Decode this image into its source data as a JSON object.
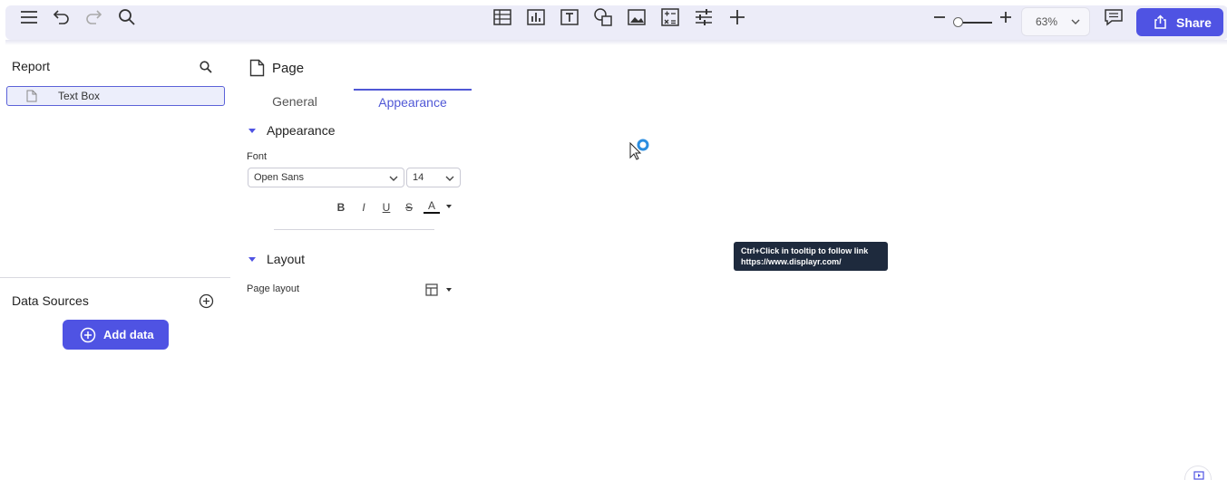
{
  "toolbar": {
    "left_icons": [
      "menu-icon",
      "undo-icon",
      "redo-icon",
      "search-icon"
    ],
    "center_icons": [
      "table-icon",
      "chart-icon",
      "text-icon",
      "shapes-icon",
      "image-icon",
      "calculation-icon",
      "controls-icon",
      "add-icon"
    ],
    "zoom_value": "63%",
    "share_label": "Share"
  },
  "left_panel": {
    "report_title": "Report",
    "report_items": [
      {
        "label": "Text Box"
      }
    ],
    "data_sources_title": "Data Sources",
    "add_data_label": "Add data"
  },
  "right_panel": {
    "page_title": "Page",
    "tabs": [
      {
        "label": "General"
      },
      {
        "label": "Appearance"
      }
    ],
    "active_tab": "Appearance",
    "appearance_section": "Appearance",
    "font_label": "Font",
    "font_value": "Open Sans",
    "font_size_value": "14",
    "format_buttons": [
      "B",
      "I",
      "U",
      "S",
      "A"
    ],
    "layout_section": "Layout",
    "page_layout_label": "Page layout"
  },
  "tooltip": {
    "line1": "Ctrl+Click in tooltip to follow link",
    "line2": "https://www.displayr.com/"
  },
  "colors": {
    "accent": "#4f53e3",
    "toolbar_bg": "#ececf8",
    "tooltip_bg": "#1e2a3d"
  }
}
